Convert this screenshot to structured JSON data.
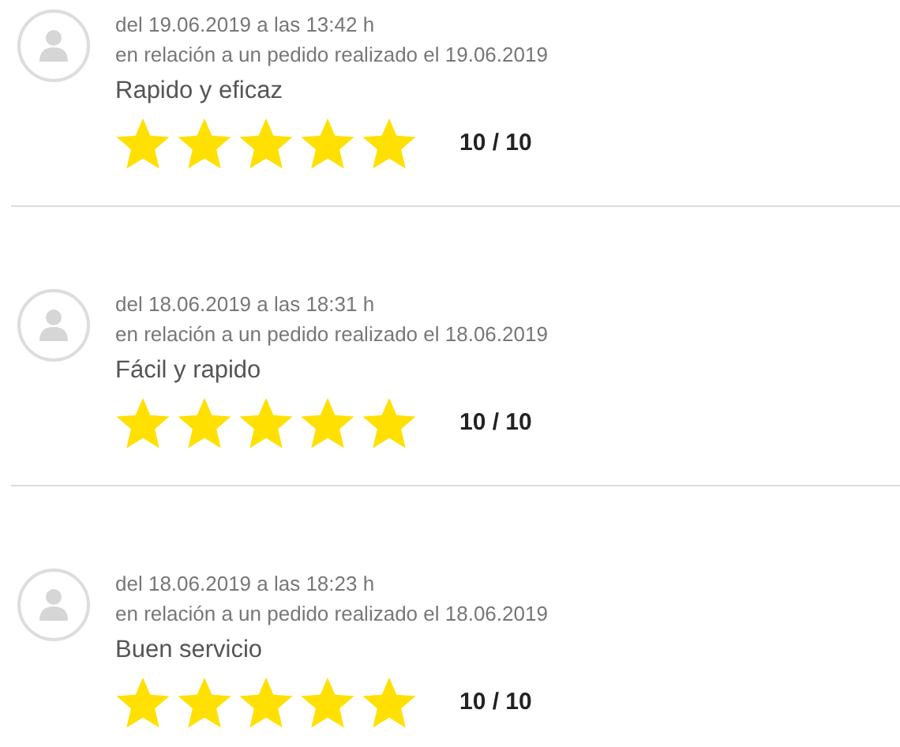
{
  "reviews": [
    {
      "date": "del 19.06.2019 a las 13:42 h",
      "order": "en relación a un pedido realizado el 19.06.2019",
      "title": "Rapido y eficaz",
      "stars": 5,
      "score": "10 / 10"
    },
    {
      "date": "del 18.06.2019 a las 18:31 h",
      "order": "en relación a un pedido realizado el 18.06.2019",
      "title": "Fácil y rapido",
      "stars": 5,
      "score": "10 / 10"
    },
    {
      "date": "del 18.06.2019 a las 18:23 h",
      "order": "en relación a un pedido realizado el 18.06.2019",
      "title": "Buen servicio",
      "stars": 5,
      "score": "10 / 10"
    }
  ]
}
